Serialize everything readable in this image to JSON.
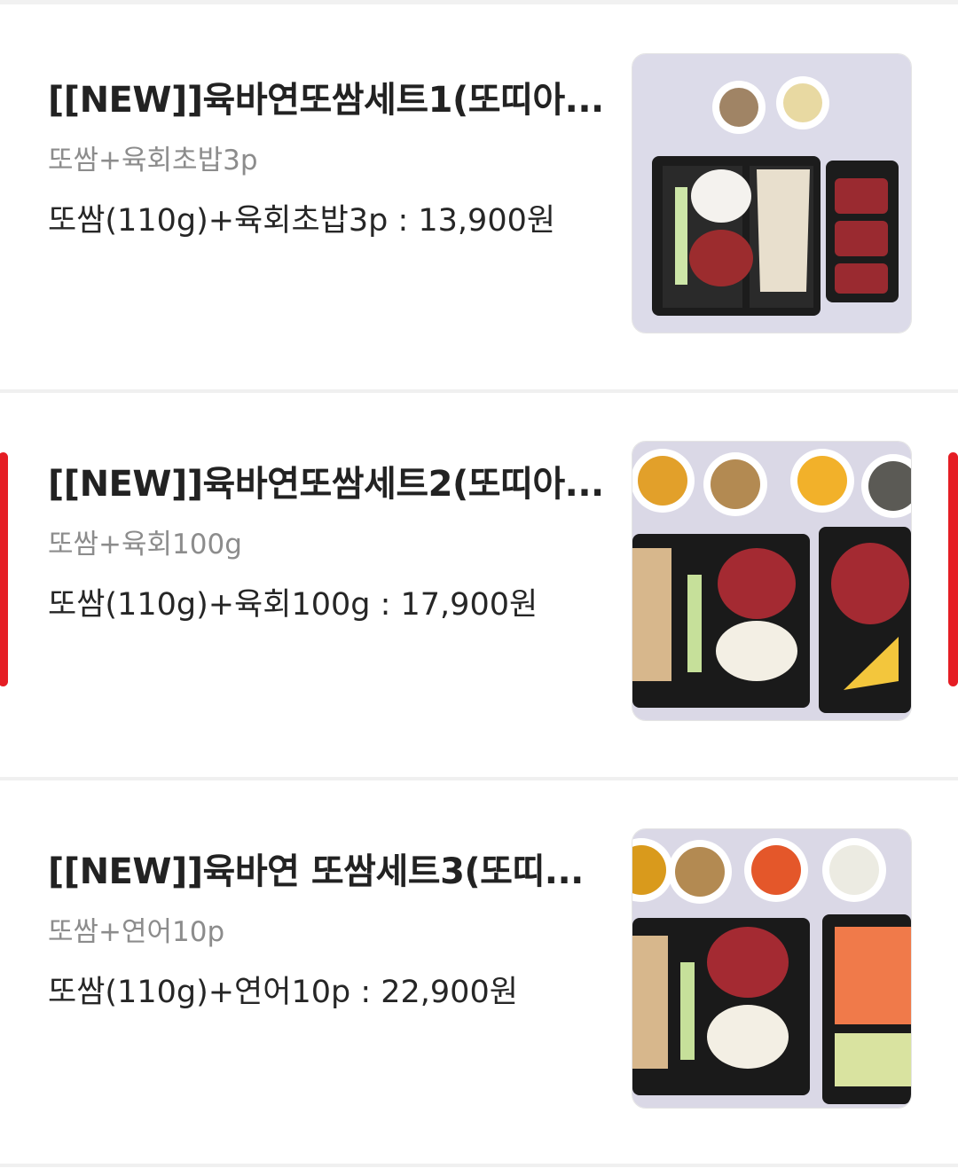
{
  "items": [
    {
      "title": "[[NEW]]육바연또쌈세트1(또띠아...",
      "subtitle": "또쌈+육회초밥3p",
      "price_line": "또쌈(110g)+육회초밥3p : 13,900원",
      "image": "tossam-set-1-photo"
    },
    {
      "title": "[[NEW]]육바연또쌈세트2(또띠아...",
      "subtitle": "또쌈+육회100g",
      "price_line": "또쌈(110g)+육회100g : 17,900원",
      "image": "tossam-set-2-photo"
    },
    {
      "title": "[[NEW]]육바연 또쌈세트3(또띠...",
      "subtitle": "또쌈+연어10p",
      "price_line": "또쌈(110g)+연어10p : 22,900원",
      "image": "tossam-set-3-photo"
    }
  ],
  "colors": {
    "accent": "#e51d24",
    "title": "#222222",
    "subtitle": "#8c8c8c",
    "divider": "#f0f0f0"
  }
}
